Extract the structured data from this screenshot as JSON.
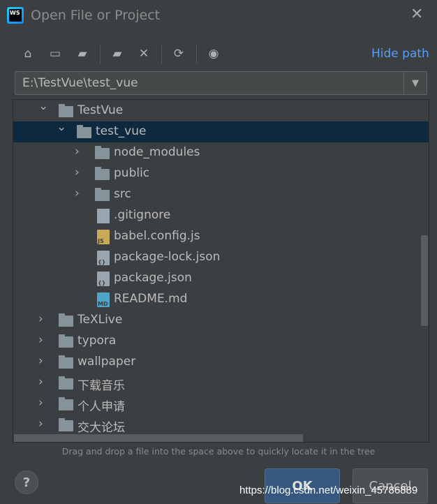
{
  "window": {
    "title": "Open File or Project",
    "logo_text": "WS"
  },
  "toolbar": {
    "icons": [
      "home-icon",
      "desktop-icon",
      "project-folder-icon",
      "new-folder-icon",
      "delete-icon",
      "refresh-icon",
      "show-hidden-icon"
    ],
    "hide_path": "Hide path"
  },
  "path": {
    "value": "E:\\TestVue\\test_vue"
  },
  "tree": [
    {
      "label": "TestVue",
      "type": "folder",
      "level": 1,
      "expanded": true
    },
    {
      "label": "test_vue",
      "type": "folder",
      "level": 2,
      "expanded": true,
      "selected": true
    },
    {
      "label": "node_modules",
      "type": "folder",
      "level": 3,
      "expanded": false
    },
    {
      "label": "public",
      "type": "folder",
      "level": 3,
      "expanded": false
    },
    {
      "label": "src",
      "type": "folder",
      "level": 3,
      "expanded": false
    },
    {
      "label": ".gitignore",
      "type": "file",
      "level": 3,
      "badge": ""
    },
    {
      "label": "babel.config.js",
      "type": "file",
      "level": 3,
      "badge": "JS"
    },
    {
      "label": "package-lock.json",
      "type": "file",
      "level": 3,
      "badge": "{}"
    },
    {
      "label": "package.json",
      "type": "file",
      "level": 3,
      "badge": "{}"
    },
    {
      "label": "README.md",
      "type": "file",
      "level": 3,
      "badge": "MD"
    },
    {
      "label": "TeXLive",
      "type": "folder",
      "level": 1,
      "expanded": false
    },
    {
      "label": "typora",
      "type": "folder",
      "level": 1,
      "expanded": false
    },
    {
      "label": "wallpaper",
      "type": "folder",
      "level": 1,
      "expanded": false
    },
    {
      "label": "下载音乐",
      "type": "folder",
      "level": 1,
      "expanded": false
    },
    {
      "label": "个人申请",
      "type": "folder",
      "level": 1,
      "expanded": false
    },
    {
      "label": "交大论坛",
      "type": "folder",
      "level": 1,
      "expanded": false
    }
  ],
  "hint": "Drag and drop a file into the space above to quickly locate it in the tree",
  "buttons": {
    "help": "?",
    "ok": "OK",
    "cancel": "Cancel"
  },
  "watermark": "https://blog.csdn.net/weixin_45786889",
  "colors": {
    "background": "#3c3f41",
    "selection": "#0d293e",
    "link": "#589df6",
    "ok": "#365880"
  }
}
